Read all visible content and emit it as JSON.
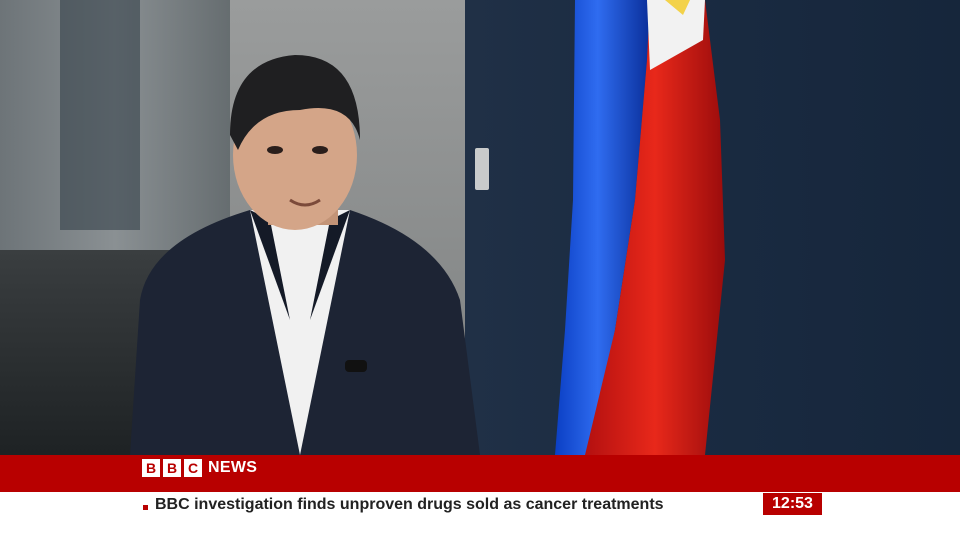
{
  "broadcast": {
    "logo_letters": [
      "B",
      "B",
      "C"
    ],
    "logo_word": "NEWS",
    "ticker": "BBC investigation finds unproven drugs sold as cancer treatments",
    "clock": "12:53"
  },
  "colors": {
    "brand_red": "#b80000",
    "ticker_bg": "#ffffff",
    "ticker_text": "#222222"
  },
  "icons": {
    "bullet": "square-bullet-icon"
  }
}
